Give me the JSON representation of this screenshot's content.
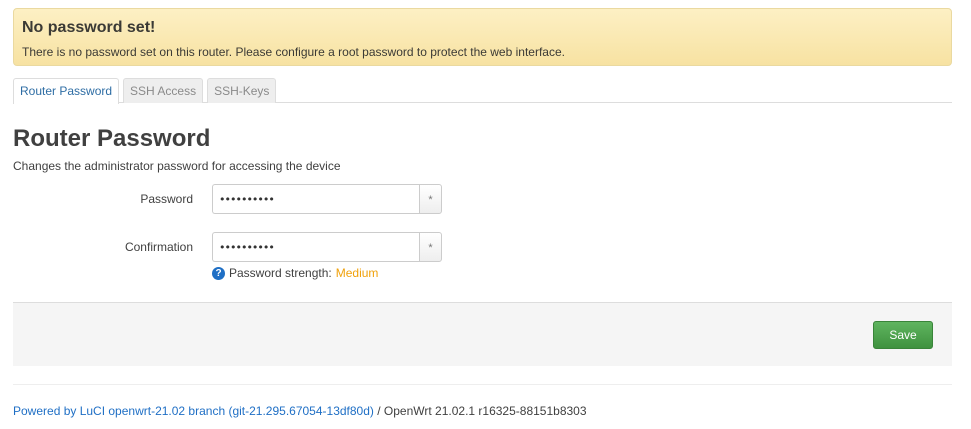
{
  "alert": {
    "title": "No password set!",
    "text": "There is no password set on this router. Please configure a root password to protect the web interface."
  },
  "tabs": [
    {
      "label": "Router Password",
      "active": true
    },
    {
      "label": "SSH Access",
      "active": false
    },
    {
      "label": "SSH-Keys",
      "active": false
    }
  ],
  "section": {
    "title": "Router Password",
    "description": "Changes the administrator password for accessing the device"
  },
  "form": {
    "password_label": "Password",
    "password_value": "••••••••••",
    "confirmation_label": "Confirmation",
    "confirmation_value": "••••••••••",
    "reveal_symbol": "*",
    "strength_label": "Password strength:",
    "strength_value": "Medium"
  },
  "actions": {
    "save_label": "Save"
  },
  "footer": {
    "link_text": "Powered by LuCI openwrt-21.02 branch (git-21.295.67054-13df80d)",
    "version_text": " / OpenWrt 21.02.1 r16325-88151b8303"
  },
  "colors": {
    "alert_bg": "#fcecb3",
    "link": "#1f6fc5",
    "strength_medium": "#f0a10b",
    "save_button": "#4cae4c"
  },
  "icons": {
    "help": "question-circle-icon"
  }
}
